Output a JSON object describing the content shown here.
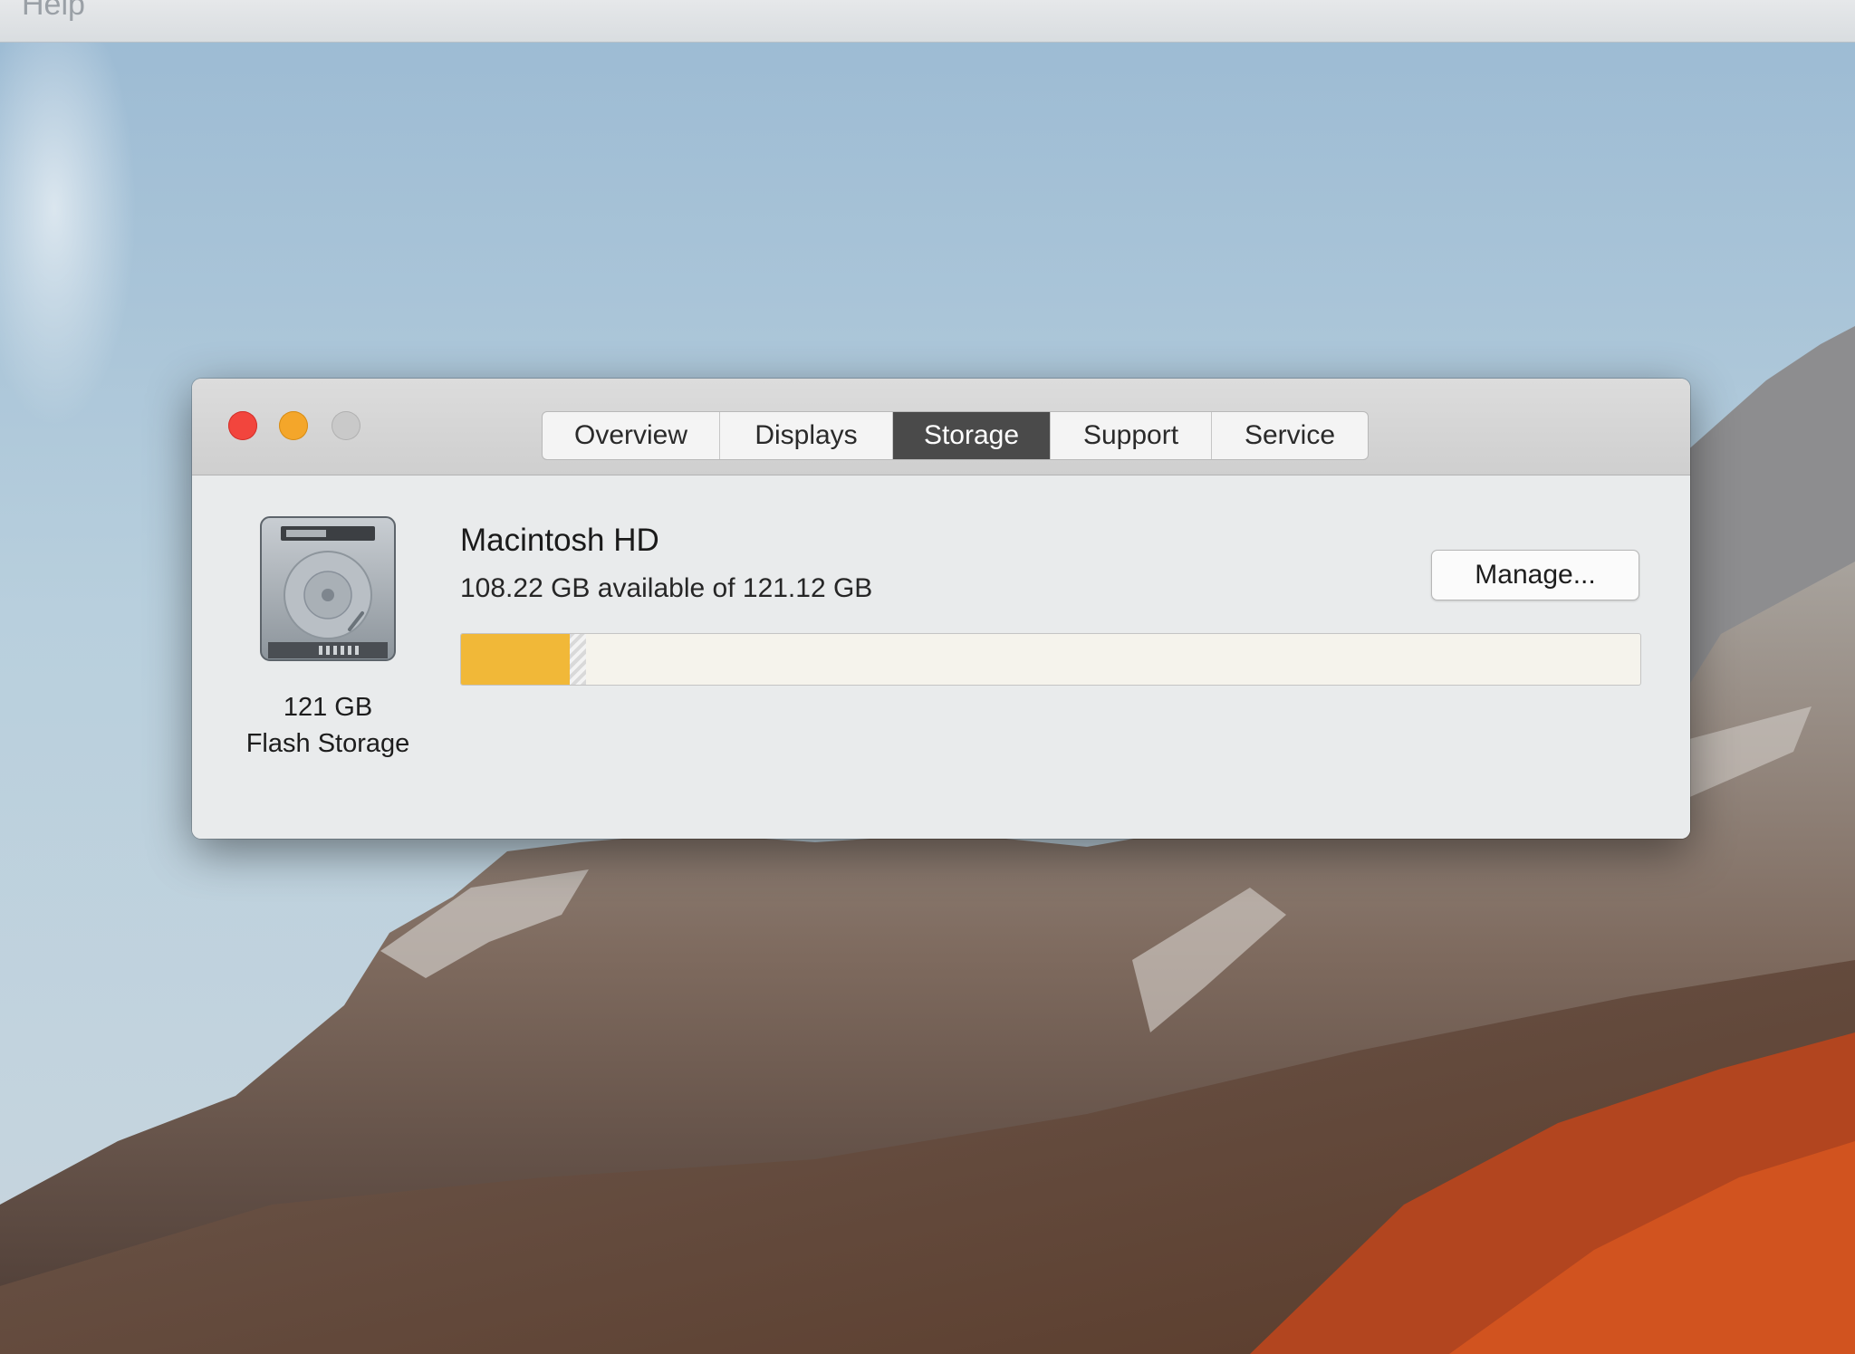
{
  "menubar": {
    "help_label": "Help"
  },
  "window": {
    "tabs": [
      {
        "label": "Overview",
        "selected": false
      },
      {
        "label": "Displays",
        "selected": false
      },
      {
        "label": "Storage",
        "selected": true
      },
      {
        "label": "Support",
        "selected": false
      },
      {
        "label": "Service",
        "selected": false
      }
    ],
    "disk": {
      "icon": "hard-drive-icon",
      "size_label": "121 GB",
      "type_label": "Flash Storage"
    },
    "volume": {
      "name": "Macintosh HD",
      "availability": "108.22 GB available of 121.12 GB",
      "manage_label": "Manage...",
      "used_fraction": 0.0922,
      "purgeable_fraction": 0.014
    }
  },
  "colors": {
    "close": "#f2453d",
    "minimize": "#f4a62a",
    "zoom": "#c9c9c9",
    "storage_used": "#f1b838",
    "selected_tab": "#4a4a4a"
  }
}
